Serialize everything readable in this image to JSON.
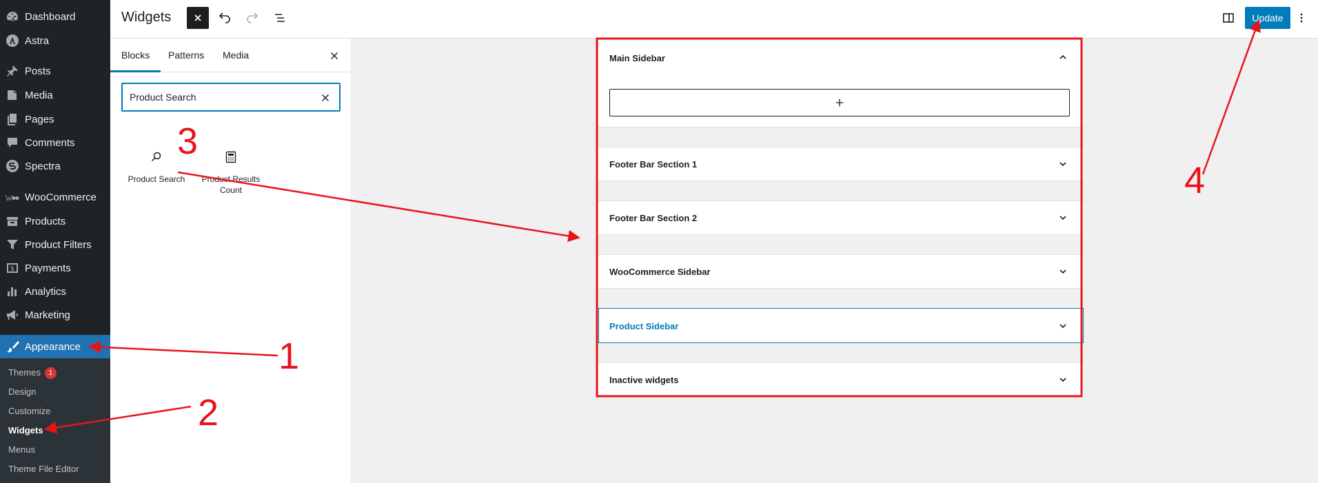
{
  "admin_menu": {
    "items": [
      {
        "label": "Dashboard",
        "icon": "dashboard-icon"
      },
      {
        "label": "Astra",
        "icon": "astra-icon"
      },
      {
        "label": "Posts",
        "icon": "pin-icon"
      },
      {
        "label": "Media",
        "icon": "media-icon"
      },
      {
        "label": "Pages",
        "icon": "pages-icon"
      },
      {
        "label": "Comments",
        "icon": "comments-icon"
      },
      {
        "label": "Spectra",
        "icon": "spectra-icon"
      },
      {
        "label": "WooCommerce",
        "icon": "woocommerce-icon"
      },
      {
        "label": "Products",
        "icon": "archive-icon"
      },
      {
        "label": "Product Filters",
        "icon": "filter-icon"
      },
      {
        "label": "Payments",
        "icon": "payments-icon"
      },
      {
        "label": "Analytics",
        "icon": "analytics-icon"
      },
      {
        "label": "Marketing",
        "icon": "megaphone-icon"
      },
      {
        "label": "Appearance",
        "icon": "brush-icon"
      }
    ],
    "submenu": [
      {
        "label": "Themes",
        "badge": "1"
      },
      {
        "label": "Design"
      },
      {
        "label": "Customize"
      },
      {
        "label": "Widgets"
      },
      {
        "label": "Menus"
      },
      {
        "label": "Theme File Editor"
      }
    ],
    "colors": {
      "bg": "#1d2327",
      "active": "#2271b1"
    }
  },
  "header": {
    "title": "Widgets",
    "update_label": "Update"
  },
  "inserter": {
    "tabs": [
      "Blocks",
      "Patterns",
      "Media"
    ],
    "search_value": "Product Search",
    "results": [
      {
        "label": "Product Search",
        "icon": "search-icon"
      },
      {
        "label": "Product Results Count",
        "icon": "calculator-icon"
      }
    ]
  },
  "widget_areas": [
    {
      "title": "Main Sidebar",
      "expanded": true
    },
    {
      "title": "Footer Bar Section 1"
    },
    {
      "title": "Footer Bar Section 2"
    },
    {
      "title": "WooCommerce Sidebar"
    },
    {
      "title": "Product Sidebar",
      "focused": true
    },
    {
      "title": "Inactive widgets"
    }
  ],
  "annotations": {
    "labels": [
      "1",
      "2",
      "3",
      "4"
    ],
    "color": "#e8141a"
  }
}
